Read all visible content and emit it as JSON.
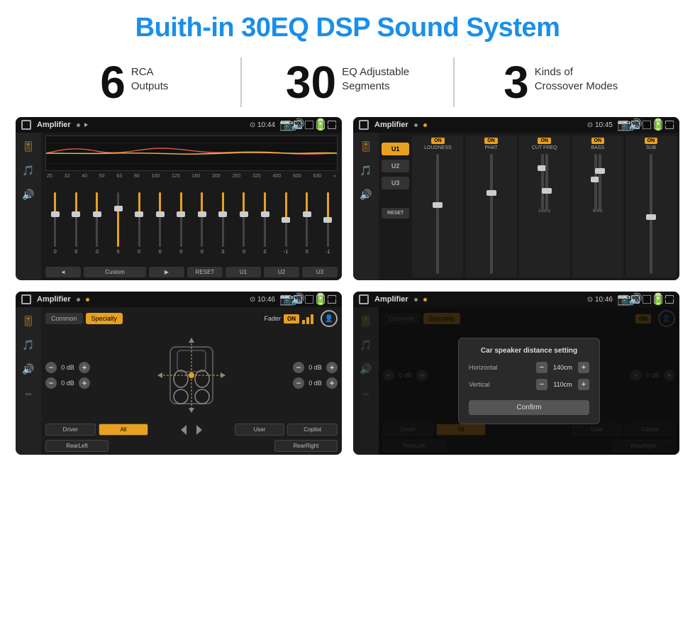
{
  "page": {
    "title": "Buith-in 30EQ DSP Sound System",
    "background": "#ffffff"
  },
  "stats": [
    {
      "number": "6",
      "line1": "RCA",
      "line2": "Outputs"
    },
    {
      "number": "30",
      "line1": "EQ Adjustable",
      "line2": "Segments"
    },
    {
      "number": "3",
      "line1": "Kinds of",
      "line2": "Crossover Modes"
    }
  ],
  "screens": [
    {
      "id": "eq-screen",
      "title": "Amplifier",
      "time": "10:44",
      "type": "eq"
    },
    {
      "id": "crossover-screen",
      "title": "Amplifier",
      "time": "10:45",
      "type": "crossover"
    },
    {
      "id": "fader-screen",
      "title": "Amplifier",
      "time": "10:46",
      "type": "fader"
    },
    {
      "id": "dialog-screen",
      "title": "Amplifier",
      "time": "10:46",
      "type": "dialog"
    }
  ],
  "eq": {
    "preset_label": "Custom",
    "buttons": [
      "◄",
      "Custom",
      "▶",
      "RESET",
      "U1",
      "U2",
      "U3"
    ],
    "frequencies": [
      "25",
      "32",
      "40",
      "50",
      "63",
      "80",
      "100",
      "125",
      "160",
      "200",
      "250",
      "320",
      "400",
      "500",
      "630"
    ],
    "values": [
      "0",
      "0",
      "0",
      "5",
      "0",
      "0",
      "0",
      "0",
      "0",
      "0",
      "0",
      "0",
      "-1",
      "0",
      "-1"
    ]
  },
  "crossover": {
    "presets": [
      "U1",
      "U2",
      "U3"
    ],
    "channels": [
      {
        "label": "LOUDNESS",
        "on": true
      },
      {
        "label": "PHAT",
        "on": true
      },
      {
        "label": "CUT FREQ",
        "on": true
      },
      {
        "label": "BASS",
        "on": true
      },
      {
        "label": "SUB",
        "on": true
      }
    ],
    "reset_label": "RESET"
  },
  "fader": {
    "tabs": [
      "Common",
      "Specialty"
    ],
    "fader_label": "Fader",
    "on_label": "ON",
    "values": [
      "0 dB",
      "0 dB",
      "0 dB",
      "0 dB"
    ],
    "buttons": [
      "Driver",
      "All",
      "Copilot",
      "RearLeft",
      "User",
      "RearRight"
    ]
  },
  "dialog": {
    "title": "Car speaker distance setting",
    "horizontal_label": "Horizontal",
    "horizontal_value": "140cm",
    "vertical_label": "Vertical",
    "vertical_value": "110cm",
    "confirm_label": "Confirm",
    "tabs": [
      "Common",
      "Specialty"
    ],
    "on_label": "ON",
    "buttons": [
      "Driver",
      "All",
      "Copilot",
      "RearLeft.",
      "User",
      "RearRight"
    ]
  }
}
